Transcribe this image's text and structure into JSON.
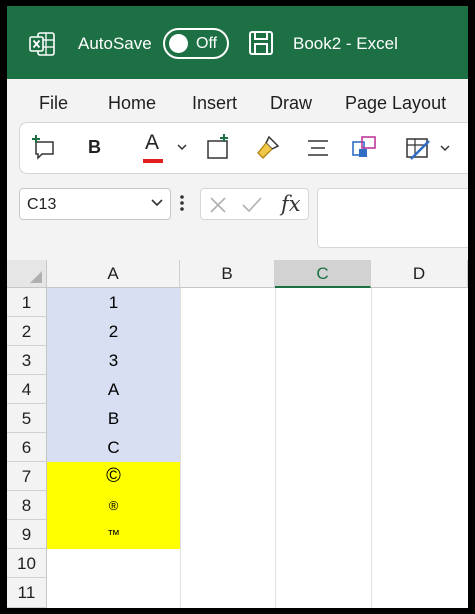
{
  "titlebar": {
    "autosave_label": "AutoSave",
    "autosave_state": "Off",
    "document_title": "Book2  -  Excel",
    "bg_color": "#1d7044"
  },
  "menu": [
    "File",
    "Home",
    "Insert",
    "Draw",
    "Page Layout"
  ],
  "toolbar": {
    "items": [
      "new-comment-icon",
      "bold-icon",
      "font-color-icon",
      "insert-sheet-icon",
      "format-painter-icon",
      "align-icon",
      "object-icon",
      "conditional-format-icon"
    ],
    "bold_label": "B",
    "font_color_label": "A",
    "font_color": "#e01e1e"
  },
  "formula_bar": {
    "name_box": "C13",
    "fx_label": "fx",
    "formula": ""
  },
  "sheet": {
    "columns": [
      "A",
      "B",
      "C",
      "D"
    ],
    "selected_column": "C",
    "rows": [
      "1",
      "2",
      "3",
      "4",
      "5",
      "6",
      "7",
      "8",
      "9",
      "10",
      "11"
    ],
    "col_a_values": [
      "1",
      "2",
      "3",
      "A",
      "B",
      "C",
      "©",
      "®",
      "™"
    ],
    "fill_colors": {
      "blue": "#d9dff2",
      "yellow": "#ffff00"
    }
  }
}
